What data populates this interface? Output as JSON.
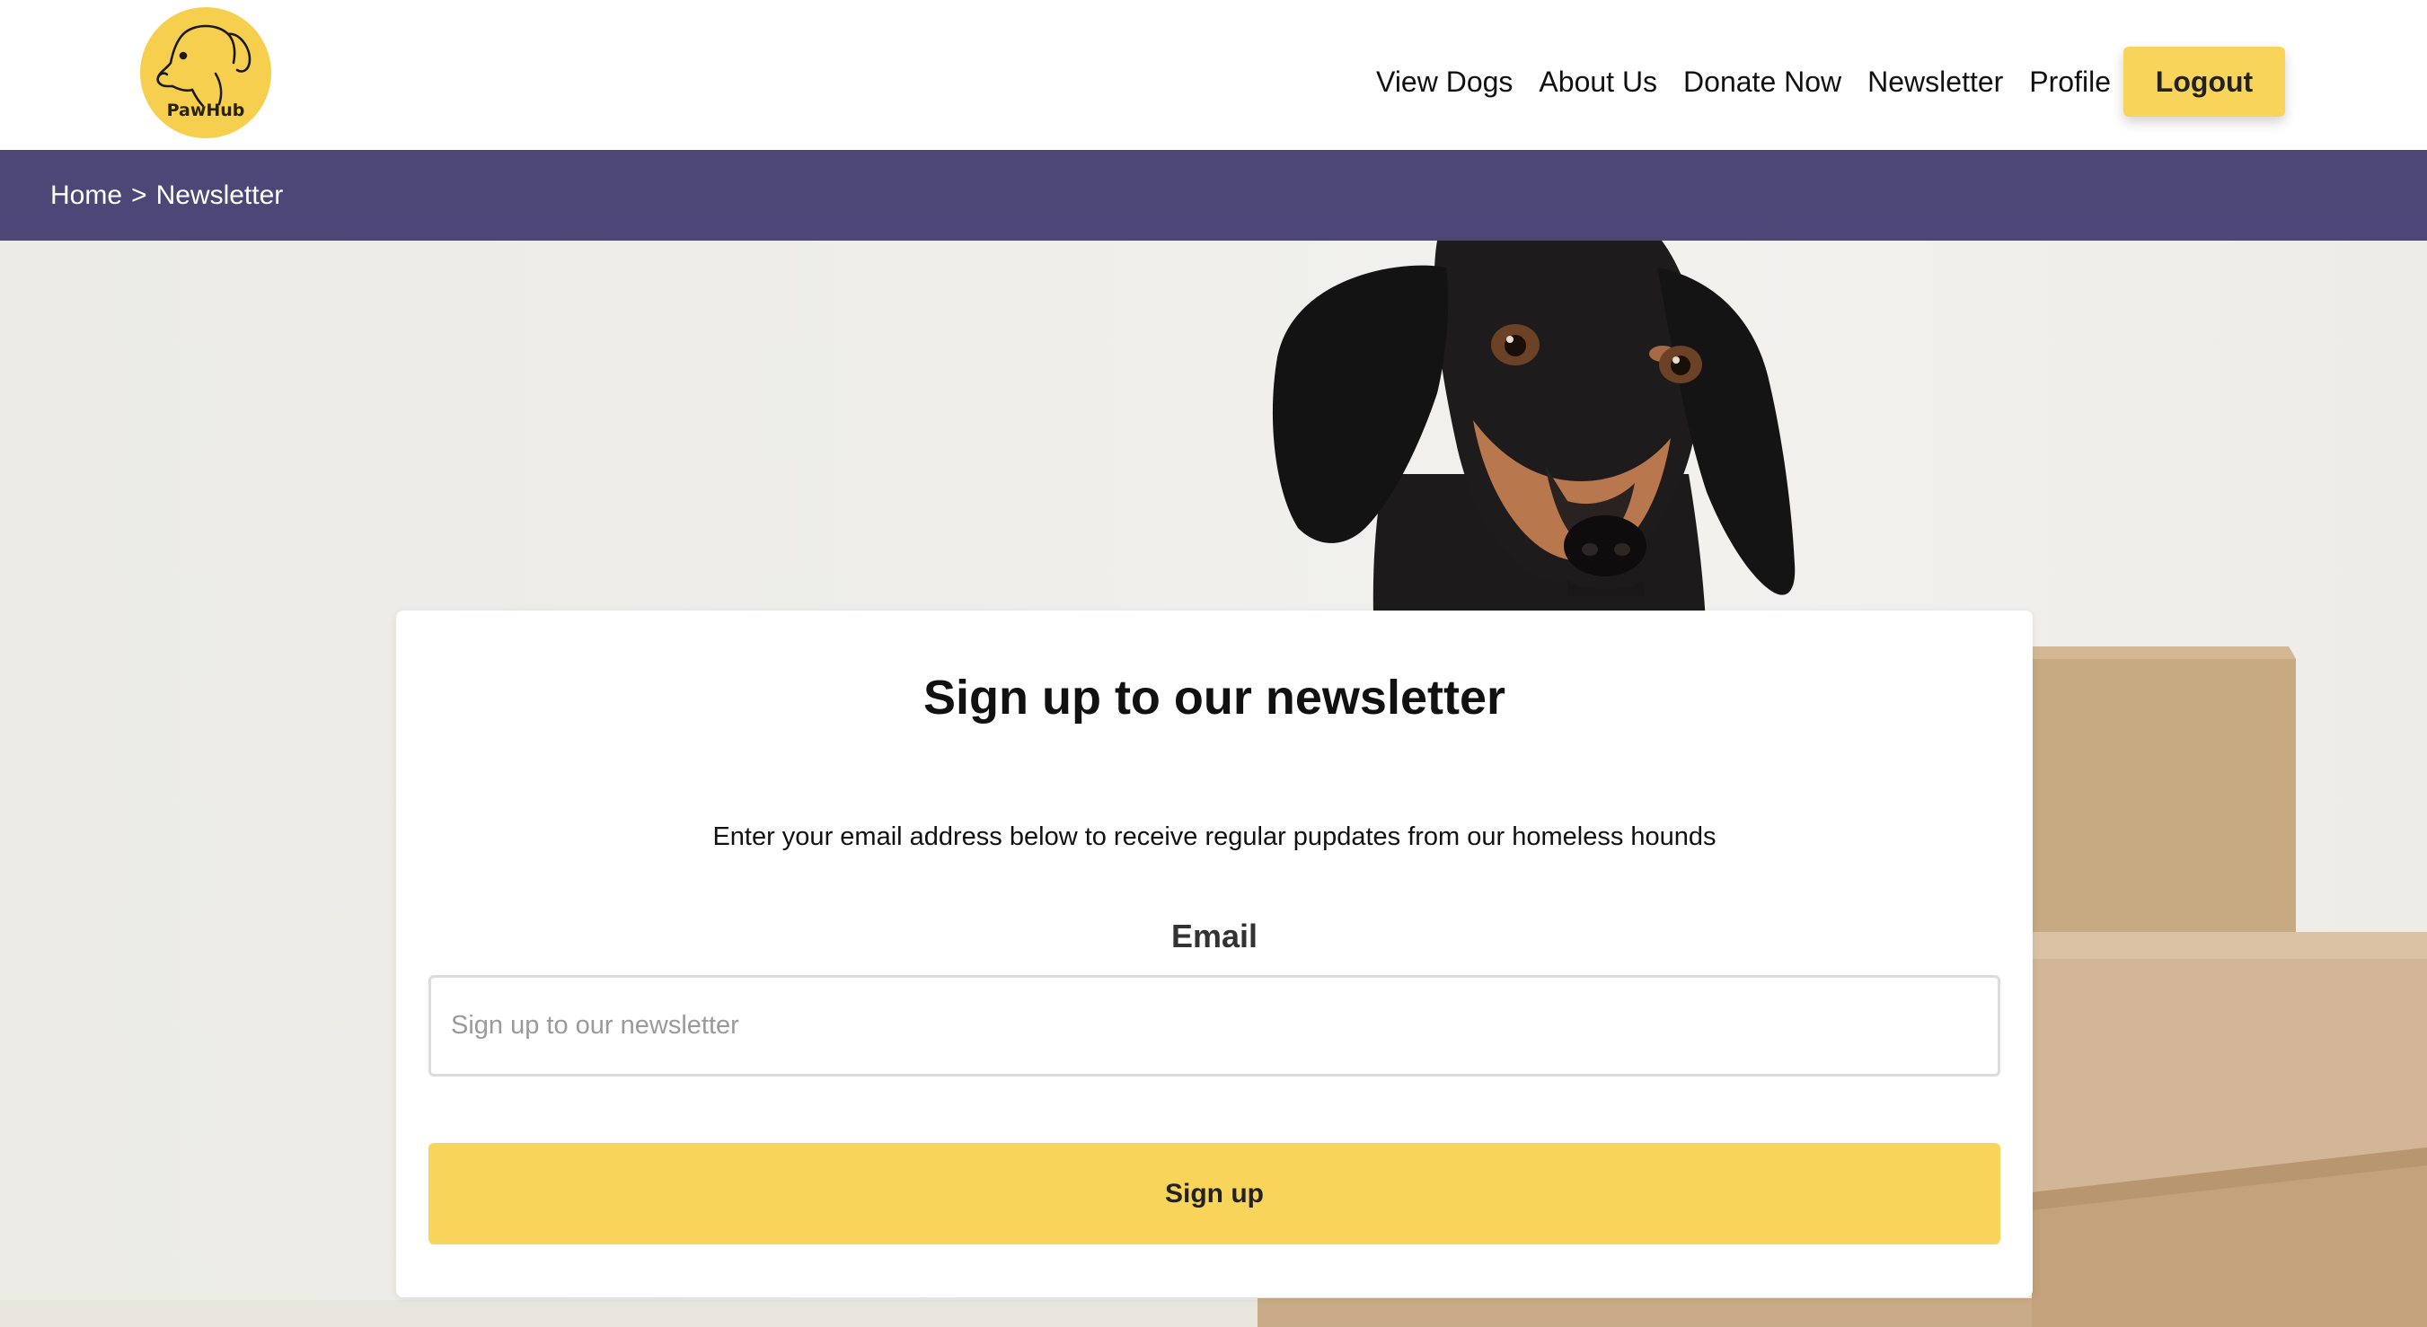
{
  "brand": {
    "logo_text": "PawHub"
  },
  "nav": {
    "items": [
      "View Dogs",
      "About Us",
      "Donate Now",
      "Newsletter",
      "Profile"
    ],
    "logout_label": "Logout"
  },
  "breadcrumb": {
    "home": "Home",
    "separator": ">",
    "current": "Newsletter"
  },
  "newsletter": {
    "title": "Sign up to our newsletter",
    "description": "Enter your email address below to receive regular pupdates from our homeless hounds",
    "email_label": "Email",
    "email_value": "",
    "email_placeholder": "Sign up to our newsletter",
    "submit_label": "Sign up"
  },
  "colors": {
    "accent_yellow": "#f8d55a",
    "breadcrumb_bar": "#4d4778",
    "text": "#111111"
  }
}
